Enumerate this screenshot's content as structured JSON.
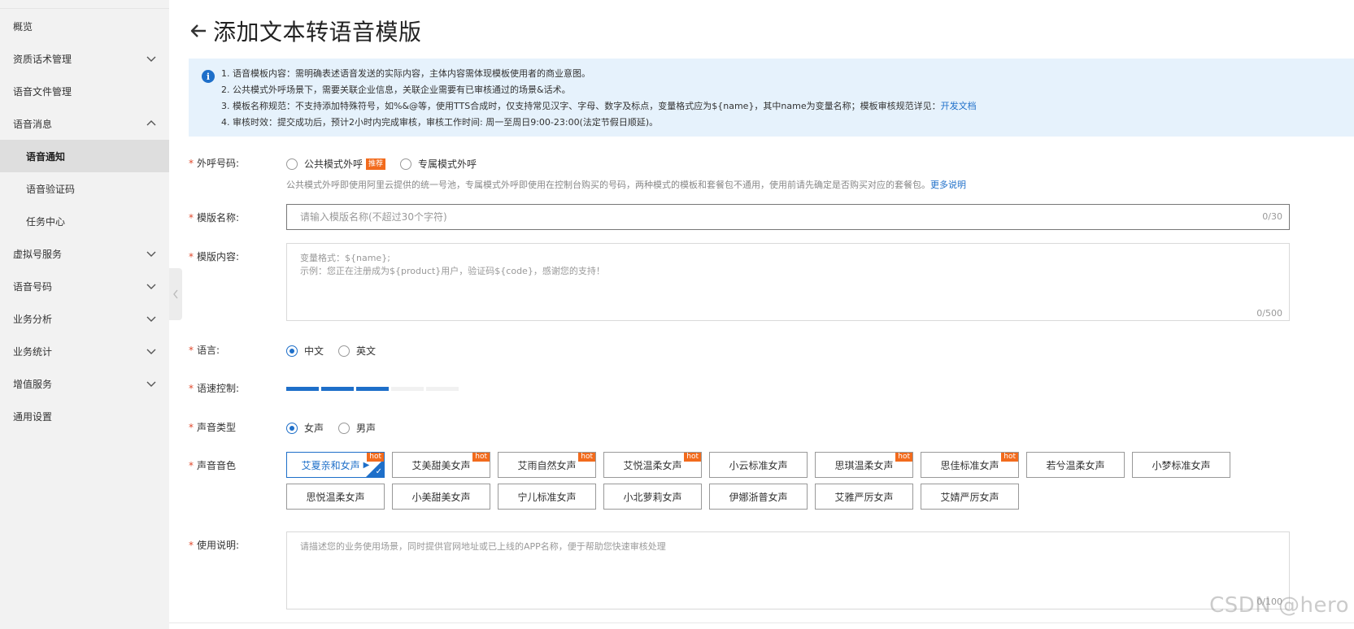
{
  "sidebar": {
    "items": [
      {
        "label": "概览"
      },
      {
        "label": "资质话术管理"
      },
      {
        "label": "语音文件管理"
      },
      {
        "label": "语音消息"
      },
      {
        "label": "语音通知"
      },
      {
        "label": "语音验证码"
      },
      {
        "label": "任务中心"
      },
      {
        "label": "虚拟号服务"
      },
      {
        "label": "语音号码"
      },
      {
        "label": "业务分析"
      },
      {
        "label": "业务统计"
      },
      {
        "label": "增值服务"
      },
      {
        "label": "通用设置"
      }
    ]
  },
  "header": {
    "title": "添加文本转语音模版"
  },
  "notice": {
    "lines": [
      "1. 语音模板内容：需明确表述语音发送的实际内容，主体内容需体现模板使用者的商业意图。",
      "2. 公共模式外呼场景下，需要关联企业信息，关联企业需要有已审核通过的场景&话术。",
      "3. 模板名称规范：不支持添加特殊符号，如%&@等，使用TTS合成时，仅支持常见汉字、字母、数字及标点，变量格式应为${name}，其中name为变量名称；模板审核规范详见：",
      "4. 审核时效：提交成功后，预计2小时内完成审核，审核工作时间: 周一至周日9:00-23:00(法定节假日顺延)。"
    ],
    "link": "开发文档"
  },
  "form": {
    "required_mark": "*",
    "outbound": {
      "label": "外呼号码:",
      "option_public": "公共模式外呼",
      "badge": "推荐",
      "option_private": "专属模式外呼",
      "hint": "公共模式外呼即使用阿里云提供的统一号池，专属模式外呼即使用在控制台购买的号码，两种模式的模板和套餐包不通用，使用前请先确定是否购买对应的套餐包。",
      "hint_link": "更多说明"
    },
    "template_name": {
      "label": "模版名称:",
      "placeholder": "请输入模版名称(不超过30个字符)",
      "counter": "0/30"
    },
    "template_content": {
      "label": "模版内容:",
      "placeholder_line1": "变量格式：${name};",
      "placeholder_line2": "示例：您正在注册成为${product}用户，验证码${code}，感谢您的支持！",
      "counter": "0/500"
    },
    "language": {
      "label": "语言:",
      "option_cn": "中文",
      "option_en": "英文",
      "selected": "中文"
    },
    "speed": {
      "label": "语速控制:",
      "level": 3,
      "max": 5
    },
    "voice_type": {
      "label": "声音类型",
      "option_female": "女声",
      "option_male": "男声",
      "selected": "女声"
    },
    "timbre": {
      "label": "声音音色",
      "hot_label": "hot",
      "voices": [
        {
          "name": "艾夏亲和女声",
          "hot": true,
          "selected": true
        },
        {
          "name": "艾美甜美女声",
          "hot": true
        },
        {
          "name": "艾雨自然女声",
          "hot": true
        },
        {
          "name": "艾悦温柔女声",
          "hot": true
        },
        {
          "name": "小云标准女声",
          "hot": false
        },
        {
          "name": "思琪温柔女声",
          "hot": true
        },
        {
          "name": "思佳标准女声",
          "hot": true
        },
        {
          "name": "若兮温柔女声",
          "hot": false
        },
        {
          "name": "小梦标准女声",
          "hot": false
        },
        {
          "name": "思悦温柔女声",
          "hot": false
        },
        {
          "name": "小美甜美女声",
          "hot": false
        },
        {
          "name": "宁儿标准女声",
          "hot": false
        },
        {
          "name": "小北萝莉女声",
          "hot": false
        },
        {
          "name": "伊娜浙普女声",
          "hot": false
        },
        {
          "name": "艾雅严厉女声",
          "hot": false
        },
        {
          "name": "艾婧严厉女声",
          "hot": false
        }
      ]
    },
    "usage": {
      "label": "使用说明:",
      "placeholder": "请描述您的业务使用场景，同时提供官网地址或已上线的APP名称，便于帮助您快速审核处理",
      "counter": "0/100"
    }
  },
  "watermark": "CSDN @hero",
  "colors": {
    "accent": "#1e6fc9",
    "hot": "#f26b1d",
    "required": "#e0492c",
    "notice_bg": "#e6f2fc",
    "sidebar_bg": "#f2f2f2"
  }
}
